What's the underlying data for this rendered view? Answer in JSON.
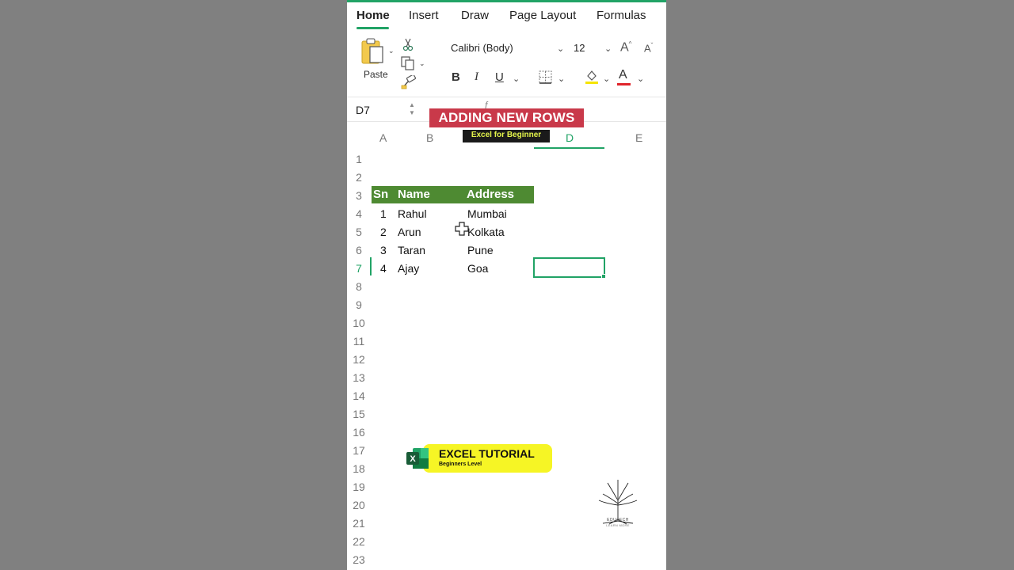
{
  "tabs": [
    {
      "label": "Home",
      "active": true
    },
    {
      "label": "Insert"
    },
    {
      "label": "Draw"
    },
    {
      "label": "Page Layout"
    },
    {
      "label": "Formulas"
    }
  ],
  "ribbon": {
    "paste_label": "Paste",
    "font_name": "Calibri (Body)",
    "font_size": "12",
    "grow_font": "A",
    "shrink_font": "A",
    "bold": "B",
    "italic": "I",
    "underline": "U",
    "font_color_letter": "A",
    "fill_color": "#f5e400",
    "font_color": "#e0242b"
  },
  "name_box": {
    "cell_ref": "D7",
    "fx": "f"
  },
  "columns": [
    "A",
    "B",
    "D",
    "E"
  ],
  "active_column": "D",
  "rows": [
    "1",
    "2",
    "3",
    "4",
    "5",
    "6",
    "7",
    "8",
    "9",
    "10",
    "11",
    "12",
    "13",
    "14",
    "15",
    "16",
    "17",
    "18",
    "19",
    "20",
    "21",
    "22",
    "23"
  ],
  "active_row": "7",
  "table": {
    "headers": [
      "Sn",
      "Name",
      "Address"
    ],
    "rows": [
      [
        "1",
        "Rahul",
        "Mumbai"
      ],
      [
        "2",
        "Arun",
        "Kolkata"
      ],
      [
        "3",
        "Taran",
        "Pune"
      ],
      [
        "4",
        "Ajay",
        "Goa"
      ]
    ],
    "header_color": "#4e8a32"
  },
  "overlay": {
    "title": "ADDING NEW ROWS",
    "subtitle": "Excel for Beginner",
    "tutorial_title": "EXCEL TUTORIAL",
    "tutorial_sub": "Beginners Level",
    "brand_caption": "EDUTECH",
    "brand_sub": "LEARN MORE"
  },
  "accent_color": "#21a366"
}
